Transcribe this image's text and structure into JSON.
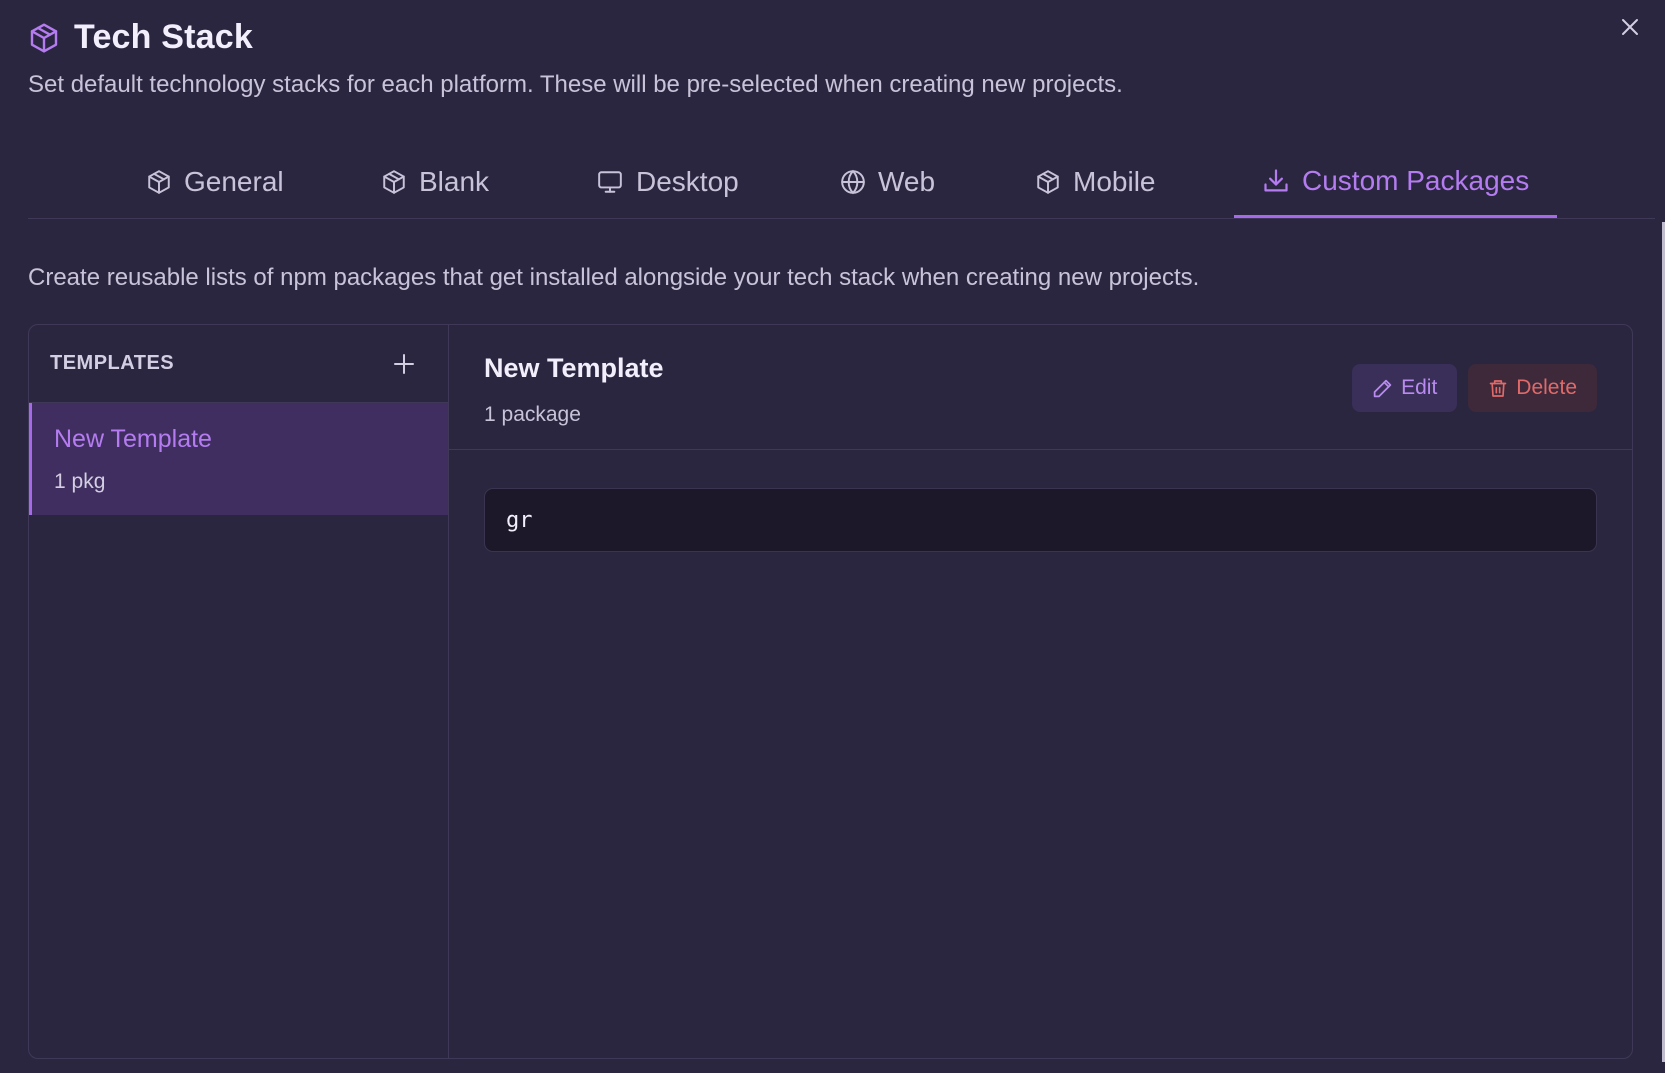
{
  "dialog": {
    "title": "Tech Stack",
    "subtitle": "Set default technology stacks for each platform. These will be pre-selected when creating new projects.",
    "close_icon": "close-icon",
    "title_icon": "package-icon"
  },
  "tabs": [
    {
      "label": "General",
      "icon": "package-icon",
      "active": false
    },
    {
      "label": "Blank",
      "icon": "package-icon",
      "active": false
    },
    {
      "label": "Desktop",
      "icon": "monitor-icon",
      "active": false
    },
    {
      "label": "Web",
      "icon": "globe-icon",
      "active": false
    },
    {
      "label": "Mobile",
      "icon": "package-icon",
      "active": false
    },
    {
      "label": "Custom Packages",
      "icon": "download-icon",
      "active": true
    }
  ],
  "custom_packages": {
    "description": "Create reusable lists of npm packages that get installed alongside your tech stack when creating new projects.",
    "sidebar": {
      "title": "TEMPLATES",
      "add_icon": "plus-icon",
      "items": [
        {
          "name": "New Template",
          "count": "1 pkg",
          "selected": true
        }
      ]
    },
    "detail": {
      "title": "New Template",
      "count": "1 package",
      "edit_label": "Edit",
      "delete_label": "Delete",
      "packages": [
        "gr"
      ]
    }
  },
  "colors": {
    "background": "#2b2640",
    "accent": "#a46ae8",
    "danger": "#e06a6a",
    "selected_bg": "#3f2e5f"
  }
}
